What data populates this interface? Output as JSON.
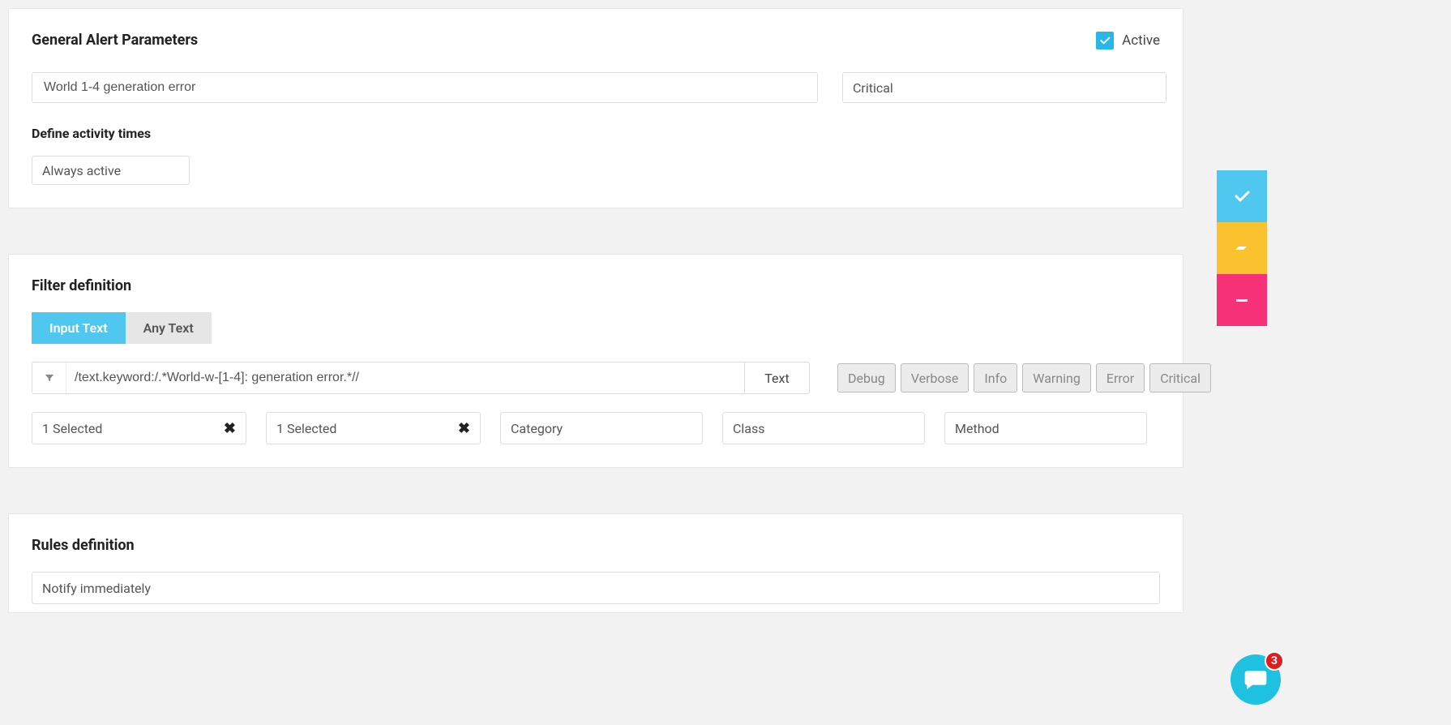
{
  "general": {
    "title": "General Alert Parameters",
    "active_checked": true,
    "active_label": "Active",
    "name_value": "World 1-4 generation error",
    "severity_value": "Critical",
    "activity_label": "Define activity times",
    "activity_value": "Always active"
  },
  "filter": {
    "title": "Filter definition",
    "tabs": {
      "input_text": "Input Text",
      "any_text": "Any Text"
    },
    "query_value": "/text.keyword:/.*World-w-[1-4]: generation error.*//",
    "query_type": "Text",
    "levels": [
      "Debug",
      "Verbose",
      "Info",
      "Warning",
      "Error",
      "Critical"
    ],
    "selects": {
      "sel1": "1 Selected",
      "sel2": "1 Selected",
      "category_ph": "Category",
      "class_ph": "Class",
      "method_ph": "Method"
    }
  },
  "rules": {
    "title": "Rules definition",
    "notify_value": "Notify immediately"
  },
  "chat": {
    "badge": "3"
  },
  "icons": {
    "check": "check-icon",
    "filter": "filter-icon",
    "eraser": "eraser-icon",
    "minus": "minus-icon",
    "chat": "chat-icon"
  }
}
